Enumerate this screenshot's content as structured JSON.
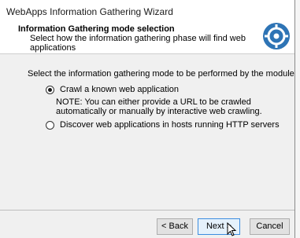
{
  "window": {
    "title": "WebApps Information Gathering Wizard"
  },
  "header": {
    "title": "Information Gathering mode selection",
    "subtitle": "Select how the information gathering phase will find web applications",
    "logo_icon": "crosshair-target-icon",
    "logo_color": "#2e74b5"
  },
  "content": {
    "prompt": "Select the information gathering mode to be performed by the module",
    "options": [
      {
        "label": "Crawl a known web application",
        "selected": true
      },
      {
        "label": "Discover web applications in hosts running HTTP servers",
        "selected": false
      }
    ],
    "note": "NOTE: You can either provide a URL to be crawled automatically or manually by interactive web crawling."
  },
  "footer": {
    "back_label": "< Back",
    "next_label": "Next >",
    "cancel_label": "Cancel"
  }
}
